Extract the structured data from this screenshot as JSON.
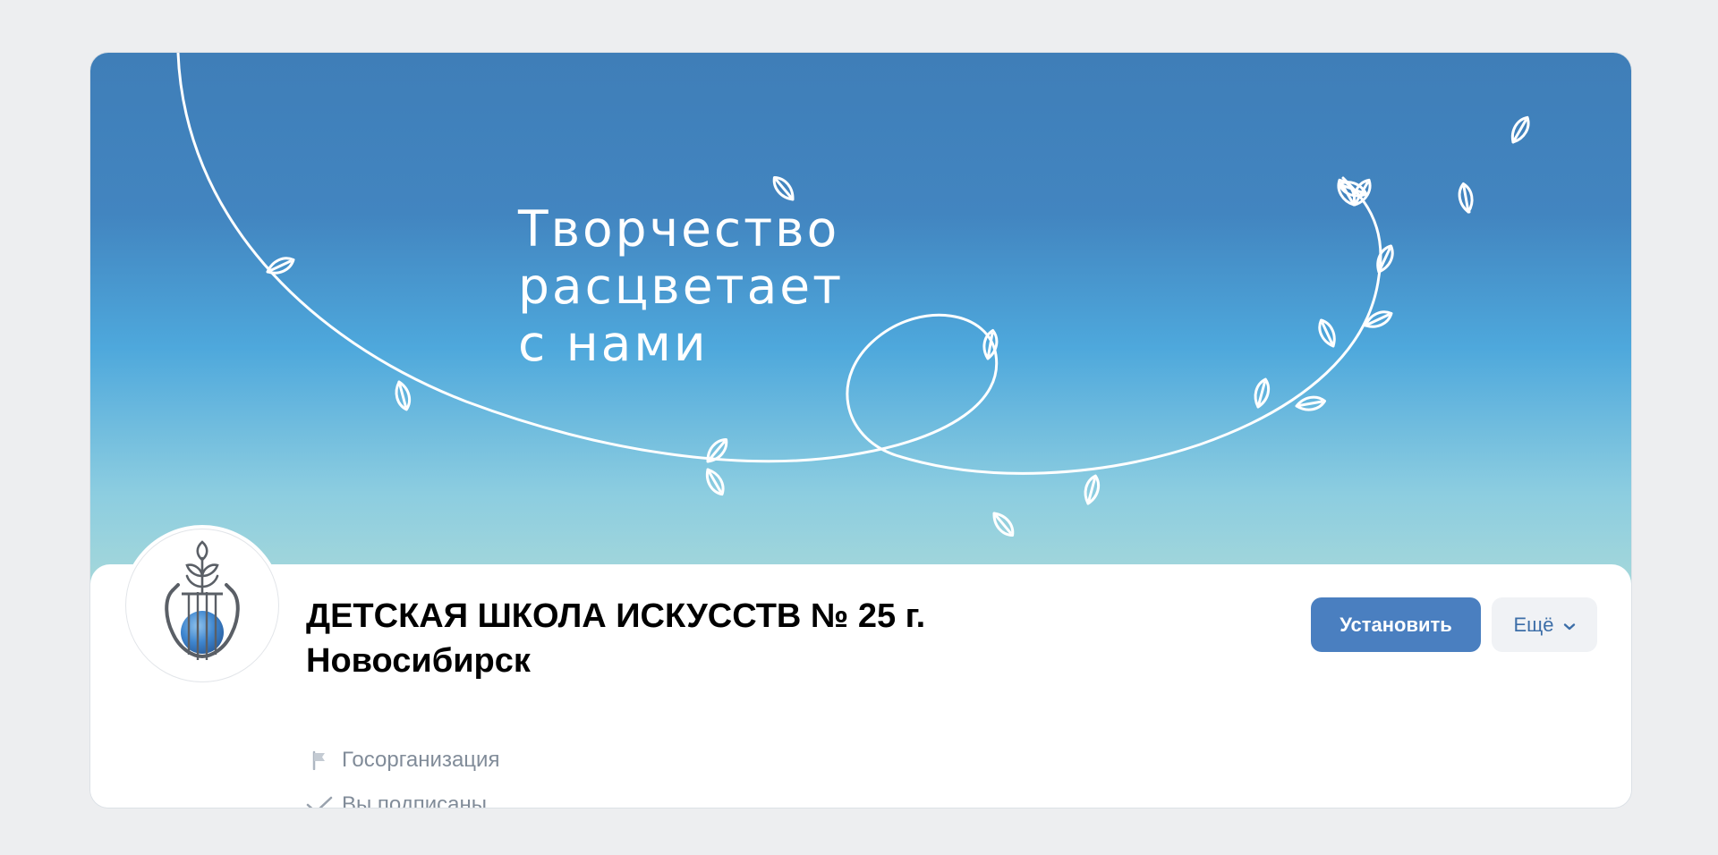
{
  "cover": {
    "slogan_lines": [
      "Творчество",
      "расцветает",
      "с нами"
    ]
  },
  "community": {
    "name_line1": "ДЕТСКАЯ ШКОЛА ИСКУССТВ № 25 г.",
    "name_line2": "Новосибирск",
    "category": "Госорганизация",
    "subscription_status": "Вы подписаны"
  },
  "actions": {
    "install_label": "Установить",
    "more_label": "Ещё"
  },
  "icons": {
    "category": "flag-icon",
    "subscribed": "check-icon",
    "more": "chevron-down-icon"
  },
  "colors": {
    "accent": "#4a7fc0",
    "secondary_text": "#818c99",
    "cover_top": "#3f7eb8",
    "cover_bottom": "#a6d8da"
  }
}
